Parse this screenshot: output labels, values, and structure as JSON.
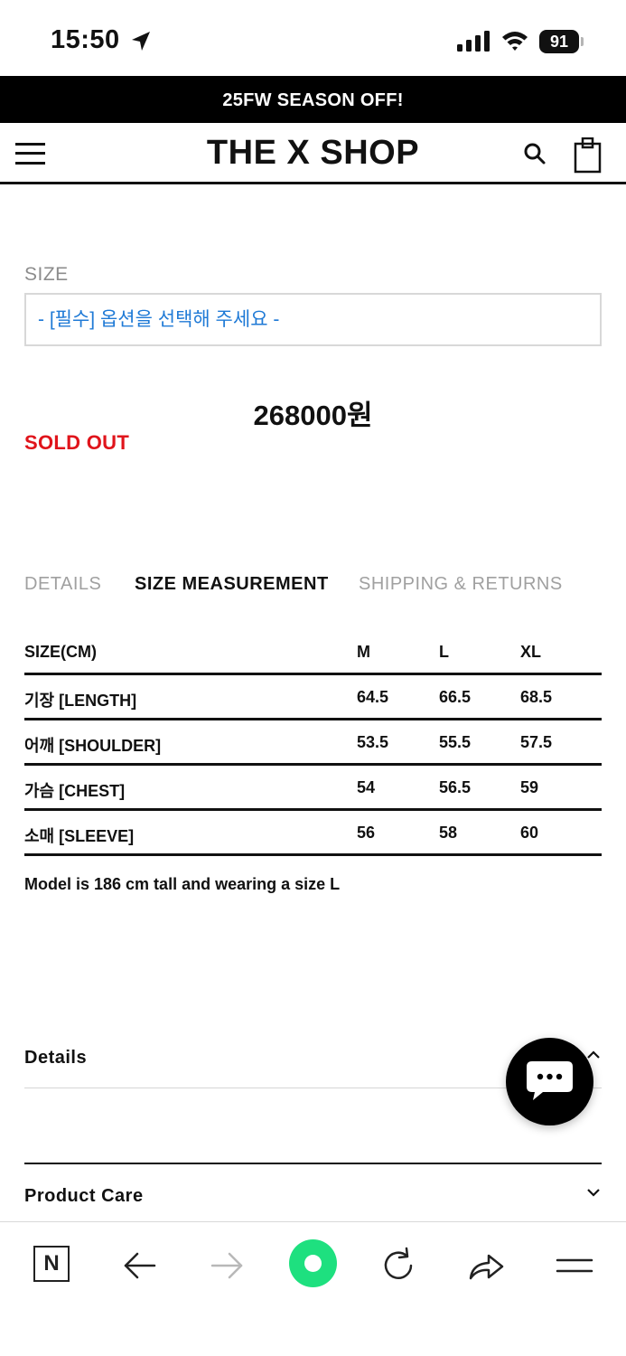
{
  "status_bar": {
    "time": "15:50",
    "battery": "91"
  },
  "promo_banner": "25FW SEASON OFF!",
  "header": {
    "title": "THE X SHOP"
  },
  "option": {
    "label": "SIZE",
    "select_value": "- [필수] 옵션을 선택해 주세요 -"
  },
  "product": {
    "price": "268000원",
    "status": "SOLD OUT"
  },
  "tabs": [
    {
      "label": "DETAILS",
      "active": false
    },
    {
      "label": "SIZE MEASUREMENT",
      "active": true
    },
    {
      "label": "SHIPPING & RETURNS",
      "active": false
    }
  ],
  "size_table": {
    "headers": [
      "SIZE(CM)",
      "M",
      "L",
      "XL"
    ],
    "rows": [
      [
        "기장 [LENGTH]",
        "64.5",
        "66.5",
        "68.5"
      ],
      [
        "어깨 [SHOULDER]",
        "53.5",
        "55.5",
        "57.5"
      ],
      [
        "가슴 [CHEST]",
        "54",
        "56.5",
        "59"
      ],
      [
        "소매 [SLEEVE]",
        "56",
        "58",
        "60"
      ]
    ]
  },
  "model_note": "Model is 186 cm tall and wearing a size L",
  "accordions": {
    "details": "Details",
    "product_care": "Product Care"
  },
  "toolbar": {
    "n_label": "N"
  },
  "colors": {
    "sold_out": "#e0141b",
    "select_text": "#1f7ad6",
    "home_button": "#1ee07f"
  }
}
